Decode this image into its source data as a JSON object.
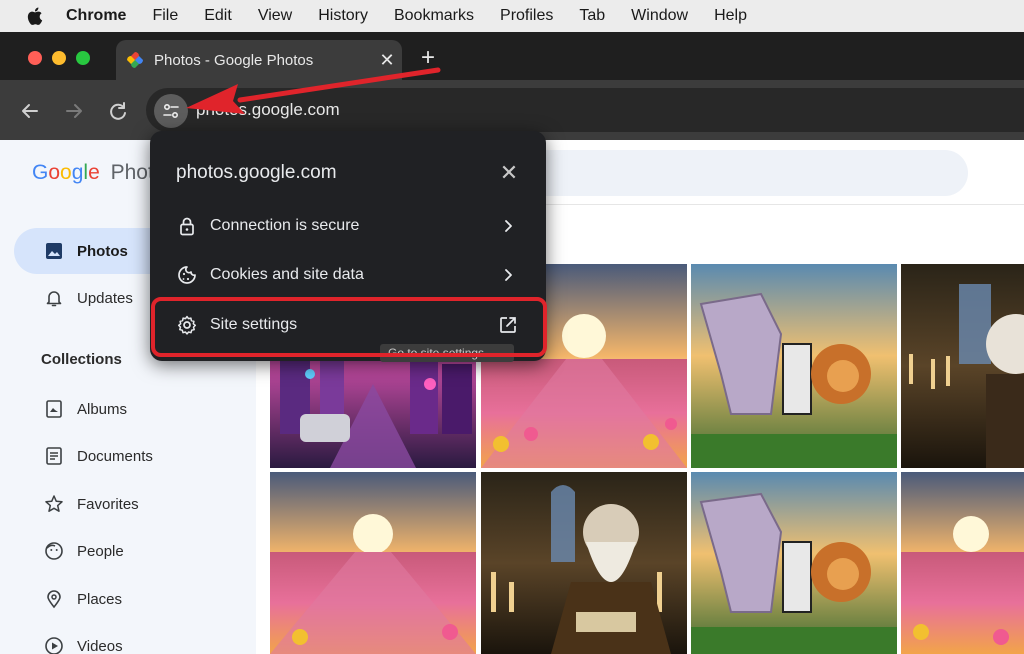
{
  "menubar": {
    "app": "Chrome",
    "items": [
      "File",
      "Edit",
      "View",
      "History",
      "Bookmarks",
      "Profiles",
      "Tab",
      "Window",
      "Help"
    ]
  },
  "tab": {
    "title": "Photos - Google Photos",
    "close": "✕"
  },
  "newtab": "+",
  "omnibox": {
    "url": "photos.google.com"
  },
  "photos_app": {
    "logo_google": [
      "G",
      "o",
      "o",
      "g",
      "l",
      "e"
    ],
    "logo_product": "Photo",
    "nav": [
      {
        "label": "Photos",
        "icon": "photo-icon",
        "active": true
      },
      {
        "label": "Updates",
        "icon": "bell-icon",
        "active": false
      }
    ],
    "collections_heading": "Collections",
    "collections": [
      {
        "label": "Albums",
        "icon": "album-icon"
      },
      {
        "label": "Documents",
        "icon": "document-icon"
      },
      {
        "label": "Favorites",
        "icon": "star-icon"
      },
      {
        "label": "People",
        "icon": "people-icon"
      },
      {
        "label": "Places",
        "icon": "pin-icon"
      },
      {
        "label": "Videos",
        "icon": "video-icon"
      }
    ]
  },
  "site_info_popup": {
    "domain": "photos.google.com",
    "close": "✕",
    "rows": [
      {
        "label": "Connection is secure",
        "icon": "lock-icon"
      },
      {
        "label": "Cookies and site data",
        "icon": "cookie-icon"
      },
      {
        "label": "Site settings",
        "icon": "gear-icon"
      }
    ],
    "tooltip": "Go to site settings"
  },
  "colors": {
    "highlight": "#e0242b",
    "arrow": "#e0242b",
    "active_nav": "#d6e4fb"
  }
}
